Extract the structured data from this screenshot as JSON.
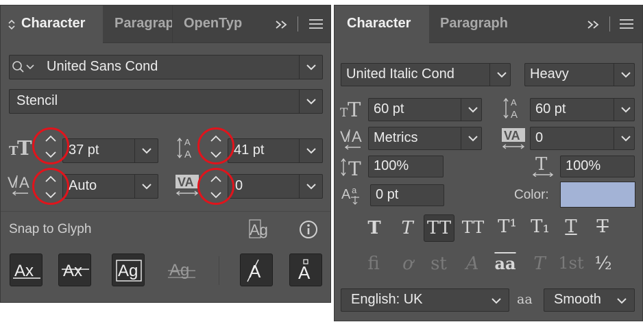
{
  "left_panel": {
    "tabs": {
      "character": "Character",
      "paragraph": "Paragrap",
      "opentype": "OpenTyp"
    },
    "font_family": "United Sans Cond",
    "font_style": "Stencil",
    "font_size": "37 pt",
    "leading": "41 pt",
    "kerning": "Auto",
    "tracking": "0",
    "snap_label": "Snap to Glyph"
  },
  "right_panel": {
    "tabs": {
      "character": "Character",
      "paragraph": "Paragraph"
    },
    "font_family": "United Italic Cond",
    "font_style": "Heavy",
    "font_size": "60 pt",
    "leading": "60 pt",
    "kerning": "Metrics",
    "tracking": "0",
    "vertical_scale": "100%",
    "horizontal_scale": "100%",
    "baseline_shift": "0 pt",
    "color_label": "Color:",
    "color_value": "#a3b3d6",
    "style_buttons": [
      "T",
      "T",
      "TT",
      "TT",
      "T¹",
      "T₁",
      "T",
      "T"
    ],
    "opentype_glyphs": [
      "fi",
      "ơ",
      "st",
      "A",
      "aa",
      "T",
      "1st",
      "½"
    ],
    "language": "English: UK",
    "antialias_label": "aa",
    "antialias": "Smooth"
  },
  "icons": {
    "expand": "double-chevron-right-icon",
    "menu": "hamburger-menu-icon"
  }
}
